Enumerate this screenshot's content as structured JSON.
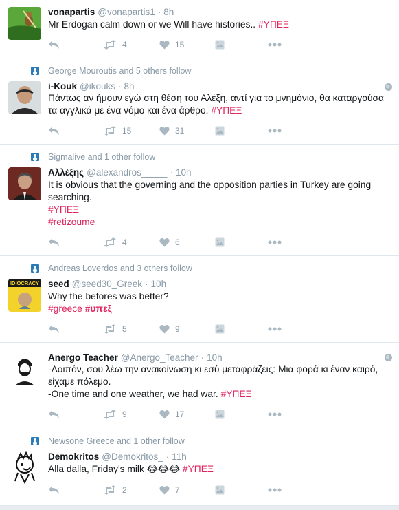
{
  "colors": {
    "hashtag": "#e0245e",
    "meta": "#8899a6",
    "icon": "#aab8c2"
  },
  "tweets": [
    {
      "context": "",
      "name": "vonapartis",
      "handle": "@vonapartis1",
      "sep": "·",
      "time": "8h",
      "lines": [
        {
          "text": "Mr Erdogan calm down or we Will have histories.. ",
          "tag": "#ΥΠΕΞ"
        }
      ],
      "retweets": "4",
      "likes": "15",
      "globe": false
    },
    {
      "context": "George Mouroutis and 5 others follow",
      "name": "i-Kouk",
      "handle": "@ikouks",
      "sep": "·",
      "time": "8h",
      "lines": [
        {
          "text": "Πάντως αν ήμουν εγώ στη θέση του Αλέξη, αντί για το μνημόνιο, θα καταργούσα",
          "tag": ""
        },
        {
          "text": "τα αγγλικά με ένα νόμο και ένα άρθρο. ",
          "tag": "#ΥΠΕΞ"
        }
      ],
      "retweets": "15",
      "likes": "31",
      "globe": true
    },
    {
      "context": "Sigmalive and 1 other follow",
      "name": "Αλλέξης",
      "handle": "@alexandros_____",
      "sep": "·",
      "time": "10h",
      "lines": [
        {
          "text": "It is obvious that the governing and the opposition parties in Turkey are going",
          "tag": ""
        },
        {
          "text": "searching.",
          "tag": ""
        },
        {
          "text": "",
          "tag": "#ΥΠΕΞ"
        },
        {
          "text": "",
          "tag": "#retizoume"
        }
      ],
      "retweets": "4",
      "likes": "6",
      "globe": false
    },
    {
      "context": "Andreas Loverdos and 3 others follow",
      "name": "seed",
      "handle": "@seed30_Greek",
      "sep": "·",
      "time": "10h",
      "lines": [
        {
          "text": "Why the befores was better?",
          "tag": ""
        },
        {
          "text": "",
          "tag": "#greece",
          "tag2": "#υπεξ"
        }
      ],
      "retweets": "5",
      "likes": "9",
      "globe": false,
      "avatar_text": "IDIOCRACY"
    },
    {
      "context": "",
      "name": "Anergo Teacher",
      "handle": "@Anergo_Teacher",
      "sep": "·",
      "time": "10h",
      "lines": [
        {
          "text": "-Λοιπόν, σου λέω την ανακοίνωση κι εσύ μεταφράζεις: Μια φορά κι έναν καιρό,",
          "tag": ""
        },
        {
          "text": "είχαμε πόλεμο.",
          "tag": ""
        },
        {
          "text": "-One time and one weather, we had war. ",
          "tag": "#ΥΠΕΞ"
        }
      ],
      "retweets": "9",
      "likes": "17",
      "globe": true
    },
    {
      "context": "Newsone Greece and 1 other follow",
      "name": "Demokritos",
      "handle": "@Demokritos_",
      "sep": "·",
      "time": "11h",
      "lines": [
        {
          "text": "Alla dalla, Friday's milk  😂😂😂  ",
          "tag": "#ΥΠΕΞ"
        }
      ],
      "retweets": "2",
      "likes": "7",
      "globe": false
    }
  ]
}
